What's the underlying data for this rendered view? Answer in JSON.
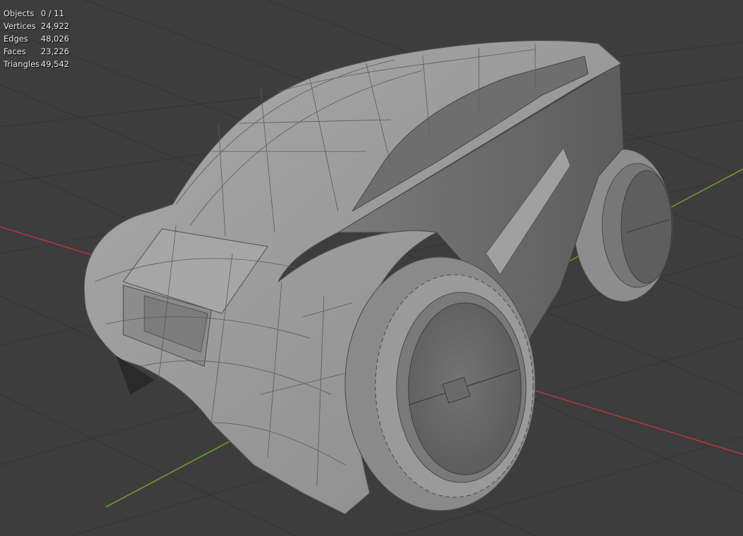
{
  "viewport": {
    "stats": [
      {
        "label": "Objects",
        "value": "0 / 11"
      },
      {
        "label": "Vertices",
        "value": "24,922"
      },
      {
        "label": "Edges",
        "value": "48,026"
      },
      {
        "label": "Faces",
        "value": "23,226"
      },
      {
        "label": "Triangles",
        "value": "49,542"
      }
    ],
    "colors": {
      "background": "#3d3d3d",
      "grid": "#353535",
      "x_axis": "#b0373f",
      "y_axis": "#6a9a2c",
      "mesh": "#9b9b9b",
      "wire": "#4a4a4a"
    }
  }
}
